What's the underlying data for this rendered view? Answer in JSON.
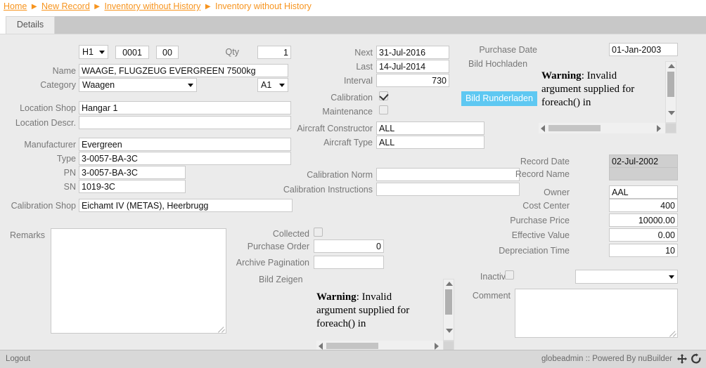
{
  "breadcrumb": {
    "items": [
      {
        "label": "Home",
        "link": true
      },
      {
        "label": "New Record",
        "link": true
      },
      {
        "label": "Inventory without History",
        "link": true
      },
      {
        "label": "Inventory without History",
        "link": false
      }
    ],
    "separator": "▶",
    "color": "#f7941e"
  },
  "tabs": [
    {
      "label": "Details",
      "active": true
    }
  ],
  "form": {
    "prefix_select": {
      "value": "H1"
    },
    "number": {
      "value": "0001"
    },
    "suffix": {
      "value": "00"
    },
    "qty": {
      "label": "Qty",
      "value": "1"
    },
    "name": {
      "label": "Name",
      "value": "WAAGE, FLUGZEUG EVERGREEN 7500kg"
    },
    "category": {
      "label": "Category",
      "value": "Waagen"
    },
    "category_code": {
      "value": "A1"
    },
    "location_shop": {
      "label": "Location Shop",
      "value": "Hangar 1"
    },
    "location_descr": {
      "label": "Location Descr.",
      "value": ""
    },
    "manufacturer": {
      "label": "Manufacturer",
      "value": "Evergreen"
    },
    "type": {
      "label": "Type",
      "value": "3-0057-BA-3C"
    },
    "pn": {
      "label": "PN",
      "value": "3-0057-BA-3C"
    },
    "sn": {
      "label": "SN",
      "value": "1019-3C"
    },
    "calibration_shop": {
      "label": "Calibration Shop",
      "value": "Eichamt IV (METAS), Heerbrugg"
    },
    "remarks": {
      "label": "Remarks",
      "value": ""
    },
    "next": {
      "label": "Next",
      "value": "31-Jul-2016"
    },
    "last": {
      "label": "Last",
      "value": "14-Jul-2014"
    },
    "interval": {
      "label": "Interval",
      "value": "730"
    },
    "calibration": {
      "label": "Calibration",
      "checked": true
    },
    "maintenance": {
      "label": "Maintenance",
      "checked": false
    },
    "aircraft_constructor": {
      "label": "Aircraft Constructor",
      "value": "ALL"
    },
    "aircraft_type": {
      "label": "Aircraft Type",
      "value": "ALL"
    },
    "calibration_norm": {
      "label": "Calibration Norm",
      "value": ""
    },
    "calibration_instructions": {
      "label": "Calibration Instructions",
      "value": ""
    },
    "collected": {
      "label": "Collected",
      "checked": false
    },
    "purchase_order": {
      "label": "Purchase Order",
      "value": "0"
    },
    "archive_pagination": {
      "label": "Archive Pagination",
      "value": ""
    },
    "bild_zeigen": {
      "label": "Bild Zeigen"
    },
    "purchase_date": {
      "label": "Purchase Date",
      "value": "01-Jan-2003"
    },
    "bild_hochladen": {
      "label": "Bild Hochladen"
    },
    "bild_runderladen": {
      "label": "Bild Runderladen",
      "color": "#5ec8f2"
    },
    "record_date": {
      "label": "Record Date",
      "value": "02-Jul-2002",
      "readonly": true
    },
    "record_name": {
      "label": "Record Name",
      "value": "",
      "readonly": true
    },
    "owner": {
      "label": "Owner",
      "value": "AAL"
    },
    "cost_center": {
      "label": "Cost Center",
      "value": "400"
    },
    "purchase_price": {
      "label": "Purchase Price",
      "value": "10000.00"
    },
    "effective_value": {
      "label": "Effective Value",
      "value": "0.00"
    },
    "depreciation_time": {
      "label": "Depreciation Time",
      "value": "10"
    },
    "inactive": {
      "label": "Inactive",
      "checked": false
    },
    "inactive_select": {
      "value": ""
    },
    "comment": {
      "label": "Comment",
      "value": ""
    }
  },
  "warnings": {
    "right": {
      "bold": "Warning",
      "rest": ": Invalid argument supplied for foreach() in"
    },
    "bottom": {
      "bold": "Warning",
      "rest": ": Invalid argument supplied for foreach() in"
    }
  },
  "footer": {
    "logout": "Logout",
    "status": "globeadmin :: Powered By nuBuilder",
    "move_icon": "move-arrows-icon",
    "refresh_icon": "refresh-icon"
  }
}
